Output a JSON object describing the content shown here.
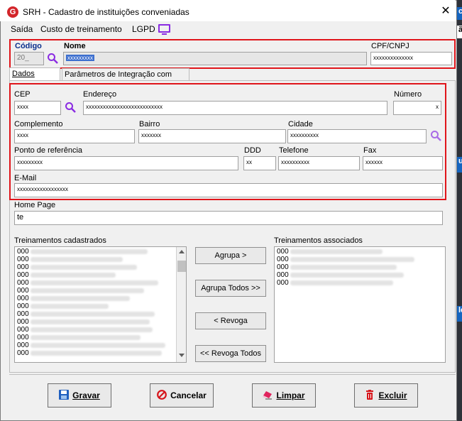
{
  "window": {
    "title": "SRH - Cadastro de instituições conveniadas",
    "close_glyph": "✕",
    "app_icon_letter": "G"
  },
  "menu": {
    "items": [
      "Saída",
      "Custo de treinamento",
      "LGPD"
    ]
  },
  "header": {
    "codigo_label": "Código",
    "codigo_value": "20_",
    "nome_label": "Nome",
    "nome_value": "xxxxxxxxx",
    "cpf_label": "CPF/CNPJ",
    "cpf_value": "xxxxxxxxxxxxxx"
  },
  "tabs": [
    "Dados Gerais",
    "Parâmetros de Integração com CPG"
  ],
  "address": {
    "cep_label": "CEP",
    "cep_value": "xxxx",
    "endereco_label": "Endereço",
    "endereco_value": "xxxxxxxxxxxxxxxxxxxxxxxxxxx",
    "numero_label": "Número",
    "numero_value": "x",
    "complemento_label": "Complemento",
    "complemento_value": "xxxx",
    "bairro_label": "Bairro",
    "bairro_value": "xxxxxxx",
    "cidade_label": "Cidade",
    "cidade_value": "xxxxxxxxxx",
    "ponto_label": "Ponto de referência",
    "ponto_value": "xxxxxxxxx",
    "ddd_label": "DDD",
    "ddd_value": "xx",
    "telefone_label": "Telefone",
    "telefone_value": "xxxxxxxxxx",
    "fax_label": "Fax",
    "fax_value": "xxxxxx",
    "email_label": "E-Mail",
    "email_value": "xxxxxxxxxxxxxxxxxx"
  },
  "homepage": {
    "label": "Home Page",
    "value": "te"
  },
  "treinamentos": {
    "cadastrados_label": "Treinamentos cadastrados",
    "associados_label": "Treinamentos associados",
    "cadastrados": [
      "000",
      "000",
      "000",
      "000",
      "000",
      "000",
      "000",
      "000",
      "000",
      "000",
      "000",
      "000",
      "000",
      "000"
    ],
    "associados": [
      "000",
      "000",
      "000",
      "000",
      "000"
    ]
  },
  "transfer_buttons": {
    "agrupa": "Agrupa >",
    "agrupa_todos": "Agrupa Todos >>",
    "revoga": "< Revoga",
    "revoga_todos": "<< Revoga Todos"
  },
  "actions": {
    "gravar": "Gravar",
    "cancelar": "Cancelar",
    "limpar": "Limpar",
    "excluir": "Excluir"
  },
  "background_tags": [
    "c",
    "ão",
    "ue",
    "ler"
  ],
  "colors": {
    "accent_red": "#e0151b",
    "icon_purple": "#8a2be2",
    "label_blue": "#0a2f8c"
  }
}
